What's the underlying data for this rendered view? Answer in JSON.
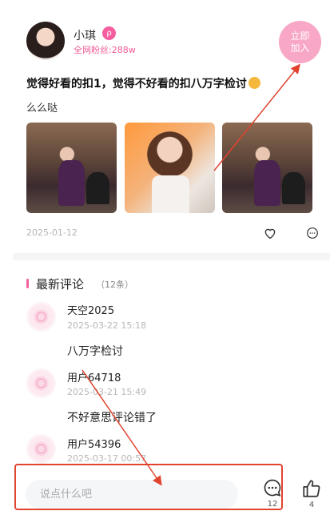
{
  "author": {
    "name": "小琪",
    "fans": "全网粉丝:288w",
    "badge_icon": "verified-badge-icon"
  },
  "join_button": {
    "line1": "立即",
    "line2": "加入"
  },
  "post": {
    "title": "觉得好看的扣1，觉得不好看的扣八万字检讨",
    "subtitle": "么么哒",
    "date": "2025-01-12"
  },
  "comments_section": {
    "title": "最新评论",
    "count": "（12条）",
    "items": [
      {
        "user": "天空2025",
        "time": "2025-03-22 15:18",
        "text": "八万字检讨"
      },
      {
        "user": "用户64718",
        "time": "2025-03-21 15:49",
        "text": "不好意思评论错了"
      },
      {
        "user": "用户54396",
        "time": "2025-03-17 00:57",
        "text": ""
      }
    ]
  },
  "bottom_bar": {
    "input_placeholder": "说点什么吧",
    "comment_count": "12",
    "like_count": "4"
  },
  "colors": {
    "accent": "#f25f9c",
    "join": "#f8a7c6",
    "annotation": "#e0442f"
  }
}
